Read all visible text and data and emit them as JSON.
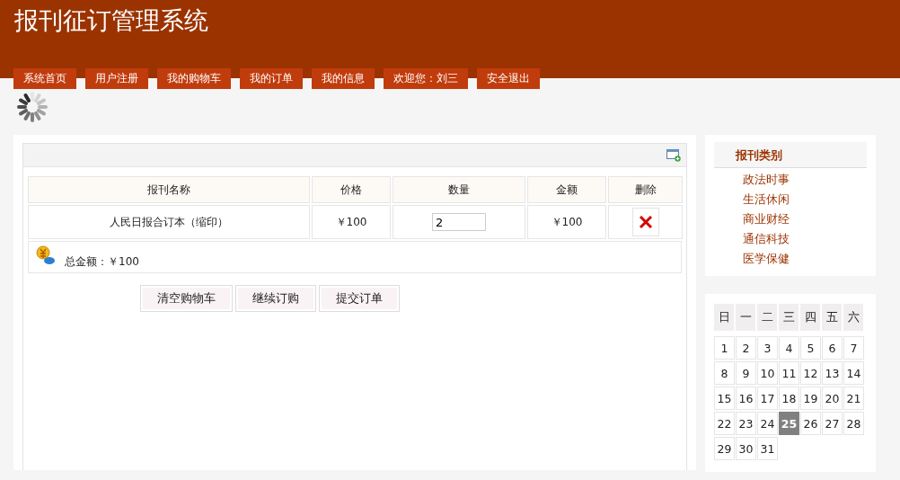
{
  "header": {
    "title": "报刊征订管理系统"
  },
  "nav": [
    {
      "label": "系统首页"
    },
    {
      "label": "用户注册"
    },
    {
      "label": "我的购物车"
    },
    {
      "label": "我的订单"
    },
    {
      "label": "我的信息"
    },
    {
      "label": "欢迎您：刘三"
    },
    {
      "label": "安全退出"
    }
  ],
  "cart": {
    "columns": [
      "报刊名称",
      "价格",
      "数量",
      "金额",
      "删除"
    ],
    "rows": [
      {
        "name": "人民日报合订本（缩印）",
        "price": "￥100",
        "quantity": "2",
        "amount": "￥100"
      }
    ],
    "total": "总金额：￥100",
    "buttons": [
      "清空购物车",
      "继续订购",
      "提交订单"
    ]
  },
  "sidebar": {
    "title": "报刊类别",
    "items": [
      "政法时事",
      "生活休闲",
      "商业财经",
      "通信科技",
      "医学保健"
    ]
  },
  "calendar": {
    "weekdays": [
      "日",
      "一",
      "二",
      "三",
      "四",
      "五",
      "六"
    ],
    "days": [
      {
        "label": "1",
        "selected": false
      },
      {
        "label": "2",
        "selected": false
      },
      {
        "label": "3",
        "selected": false
      },
      {
        "label": "4",
        "selected": false
      },
      {
        "label": "5",
        "selected": false
      },
      {
        "label": "6",
        "selected": false
      },
      {
        "label": "7",
        "selected": false
      },
      {
        "label": "8",
        "selected": false
      },
      {
        "label": "9",
        "selected": false
      },
      {
        "label": "10",
        "selected": false
      },
      {
        "label": "11",
        "selected": false
      },
      {
        "label": "12",
        "selected": false
      },
      {
        "label": "13",
        "selected": false
      },
      {
        "label": "14",
        "selected": false
      },
      {
        "label": "15",
        "selected": false
      },
      {
        "label": "16",
        "selected": false
      },
      {
        "label": "17",
        "selected": false
      },
      {
        "label": "18",
        "selected": false
      },
      {
        "label": "19",
        "selected": false
      },
      {
        "label": "20",
        "selected": false
      },
      {
        "label": "21",
        "selected": false
      },
      {
        "label": "22",
        "selected": false
      },
      {
        "label": "23",
        "selected": false
      },
      {
        "label": "24",
        "selected": false
      },
      {
        "label": "25",
        "selected": true
      },
      {
        "label": "26",
        "selected": false
      },
      {
        "label": "27",
        "selected": false
      },
      {
        "label": "28",
        "selected": false
      },
      {
        "label": "29",
        "selected": false
      },
      {
        "label": "30",
        "selected": false
      },
      {
        "label": "31",
        "selected": false
      }
    ]
  }
}
